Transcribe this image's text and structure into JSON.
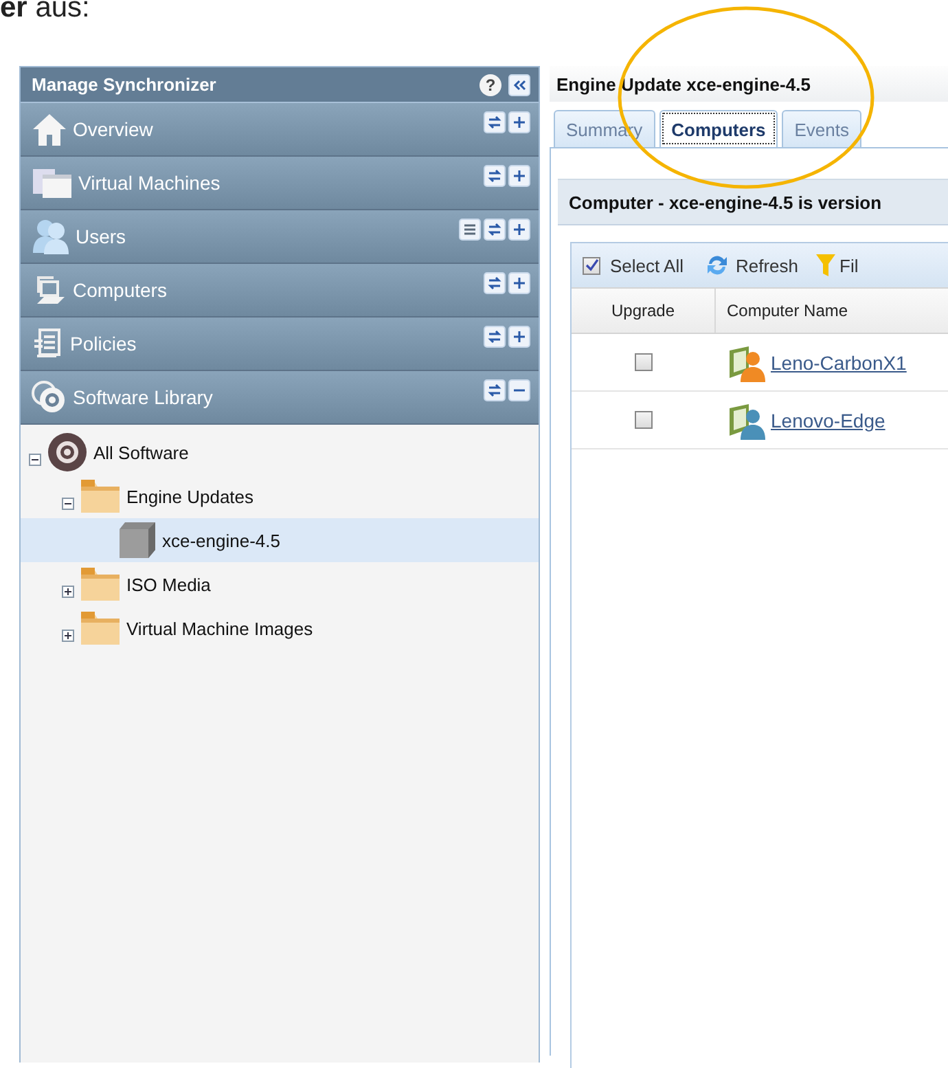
{
  "intro_text": "**er** aus:",
  "sidebar": {
    "title": "Manage Synchronizer",
    "help": "?",
    "items": [
      {
        "label": "Overview",
        "expanded": false
      },
      {
        "label": "Virtual Machines",
        "expanded": false
      },
      {
        "label": "Users",
        "expanded": false
      },
      {
        "label": "Computers",
        "expanded": false
      },
      {
        "label": "Policies",
        "expanded": false
      },
      {
        "label": "Software Library",
        "expanded": true
      }
    ],
    "tree": [
      {
        "label": "All Software",
        "expanded": true,
        "selected": false,
        "children": [
          {
            "label": "Engine Updates",
            "expanded": true,
            "selected": false,
            "children": [
              {
                "label": "xce-engine-4.5",
                "selected": true
              }
            ]
          },
          {
            "label": "ISO Media",
            "expanded": false,
            "selected": false
          },
          {
            "label": "Virtual Machine Images",
            "expanded": false,
            "selected": false
          }
        ]
      }
    ]
  },
  "detail": {
    "title": "Engine Update xce-engine-4.5",
    "tabs": [
      {
        "label": "Summary",
        "selected": false
      },
      {
        "label": "Computers",
        "selected": true
      },
      {
        "label": "Events",
        "selected": false
      }
    ],
    "section_heading": "Computer - xce-engine-4.5 is version",
    "toolbar": {
      "select_all": {
        "label": "Select All",
        "checked": true
      },
      "refresh": "Refresh",
      "filter": "Fil"
    },
    "columns": [
      "Upgrade",
      "Computer Name"
    ],
    "rows": [
      {
        "checked": false,
        "name": "Leno-CarbonX1",
        "color": "#f08a24"
      },
      {
        "checked": false,
        "name": "Lenovo-Edge",
        "color": "#4a90b8"
      }
    ]
  }
}
